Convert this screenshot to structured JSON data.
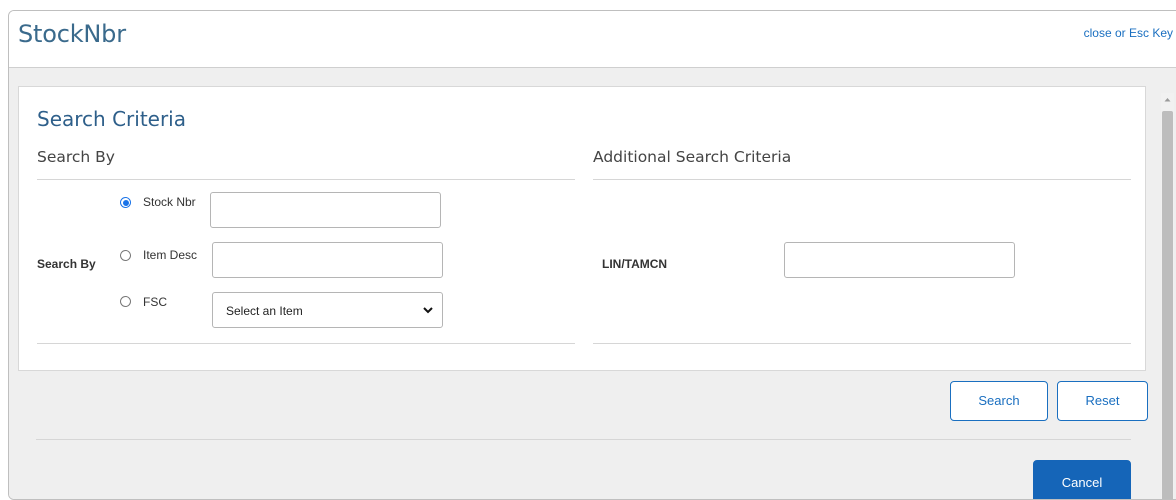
{
  "modal": {
    "title": "StockNbr",
    "close_label": "close or Esc Key"
  },
  "criteria": {
    "title": "Search Criteria",
    "search_by_heading": "Search By",
    "additional_heading": "Additional Search Criteria",
    "search_by_label": "Search By",
    "options": [
      {
        "label": "Stock Nbr",
        "selected": true
      },
      {
        "label": "Item Desc",
        "selected": false
      },
      {
        "label": "FSC",
        "selected": false
      }
    ],
    "stock_nbr_value": "",
    "item_desc_value": "",
    "fsc_select": "Select an Item",
    "lin_label": "LIN/TAMCN",
    "lin_value": ""
  },
  "buttons": {
    "search": "Search",
    "reset": "Reset",
    "cancel": "Cancel"
  },
  "colors": {
    "accent": "#1a6fc0",
    "primary_button": "#1565b8",
    "title": "#3a6a8c"
  }
}
